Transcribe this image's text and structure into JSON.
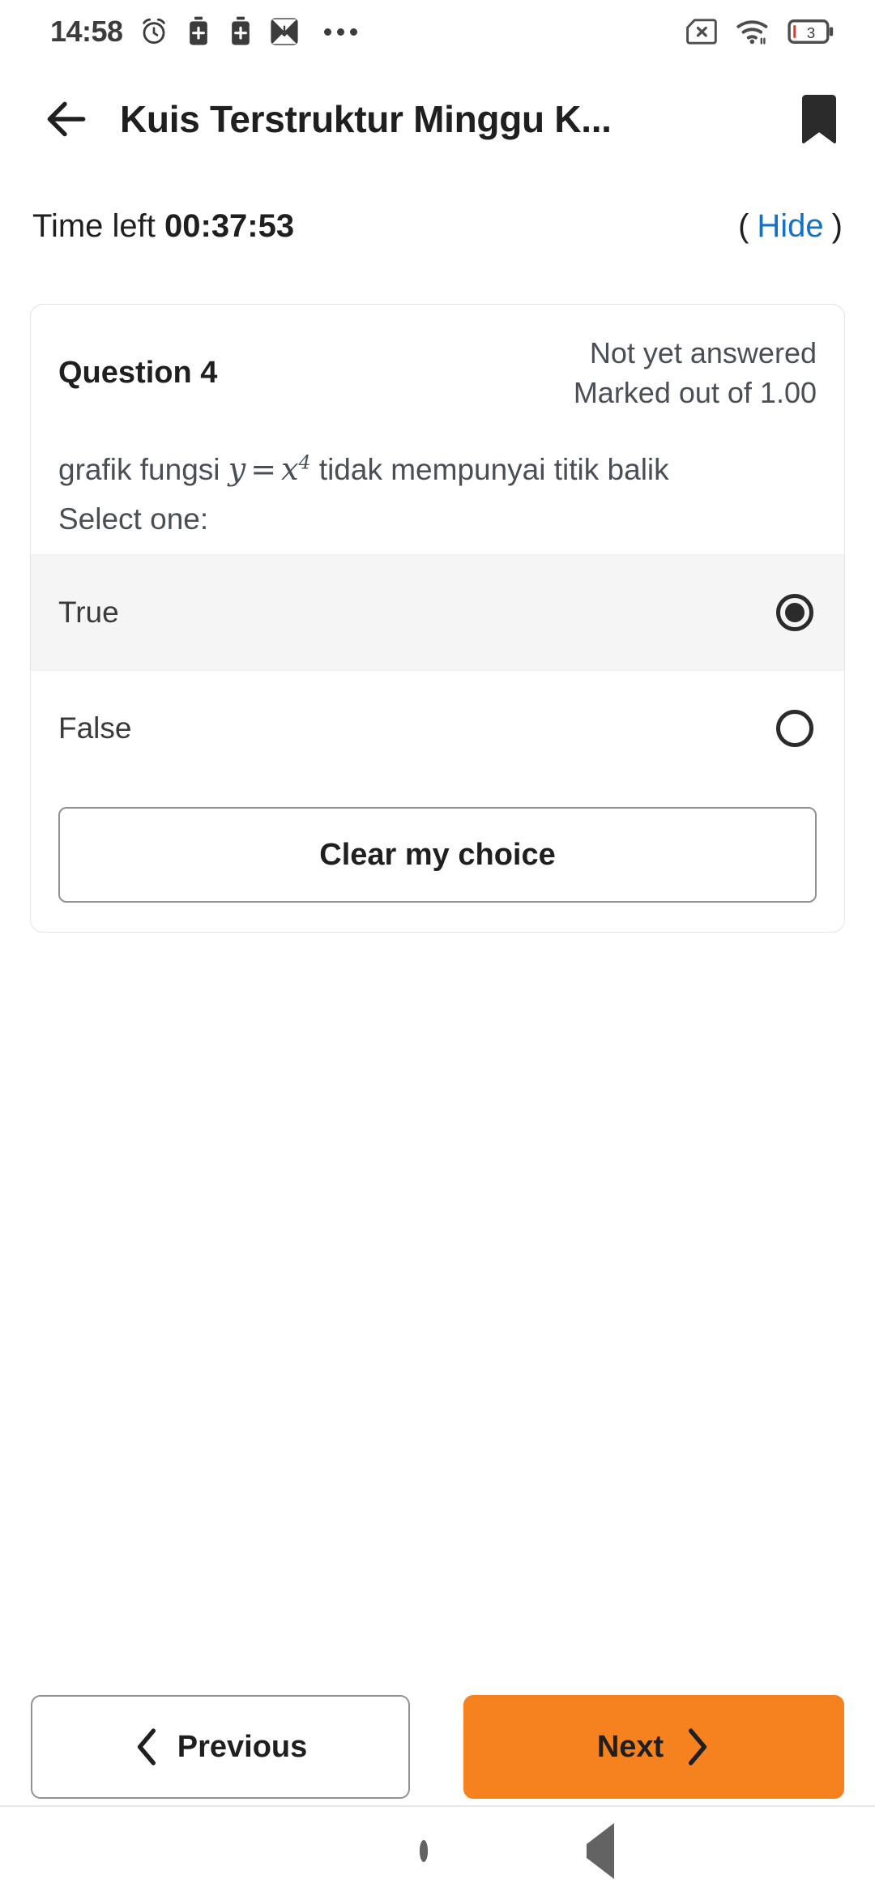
{
  "statusbar": {
    "clock": "14:58",
    "icons_left": [
      "alarm-icon",
      "battery-saver-icon",
      "battery-saver-icon",
      "download-arrow-icon",
      "overflow-dots-icon"
    ],
    "icons_right": [
      "no-sim-icon",
      "wifi-icon",
      "battery-icon"
    ],
    "battery_level": "3"
  },
  "appbar": {
    "back_icon": "arrow-left-icon",
    "title": "Kuis Terstruktur Minggu K...",
    "bookmark_icon": "bookmark-icon"
  },
  "timer": {
    "label": "Time left ",
    "value": "00:37:53",
    "paren_open": "(",
    "hide_label": "Hide",
    "paren_close": ")"
  },
  "question": {
    "number_label": "Question 4",
    "status": "Not yet answered",
    "marks": "Marked out of 1.00",
    "text_before_math": "grafik fungsi ",
    "math_y": "y",
    "math_eq": "=",
    "math_x": "x",
    "math_exp": "4",
    "text_after_math": " tidak mempunyai titik balik",
    "select_prompt": "Select one:",
    "options": [
      {
        "label": "True",
        "selected": true
      },
      {
        "label": "False",
        "selected": false
      }
    ],
    "clear_label": "Clear my choice"
  },
  "footer": {
    "previous_label": "Previous",
    "next_label": "Next",
    "prev_icon": "chevron-left-icon",
    "next_icon": "chevron-right-icon",
    "next_bg": "#F5821F"
  },
  "androidnav": {
    "recents_icon": "square-recents-icon",
    "home_icon": "circle-home-icon",
    "back_icon": "triangle-back-icon"
  },
  "colors": {
    "accent_orange": "#F5821F",
    "link_blue": "#1273c6",
    "selected_row_bg": "#f5f5f5",
    "text_dark": "#1f1f1f",
    "text_muted": "#4a4f57"
  }
}
